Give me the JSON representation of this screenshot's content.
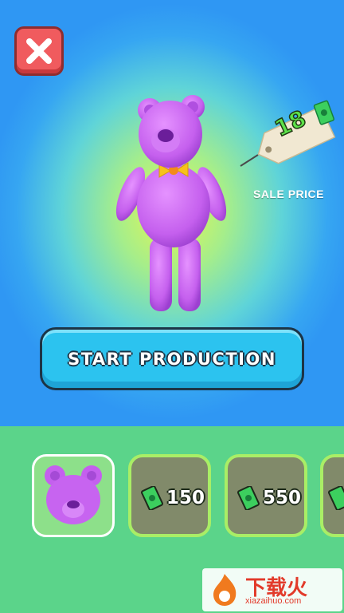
{
  "product": {
    "name_icon": "teddy-bear",
    "color": "#c764f0",
    "sale_price": "18",
    "sale_price_label": "SALE PRICE"
  },
  "actions": {
    "start_label": "START PRODUCTION",
    "close_icon": "close-icon"
  },
  "shop": {
    "items": [
      {
        "icon": "teddy-bear-head",
        "state": "selected"
      },
      {
        "icon": "cash-icon",
        "cost": "150",
        "state": "locked"
      },
      {
        "icon": "cash-icon",
        "cost": "550",
        "state": "locked"
      },
      {
        "icon": "cash-icon",
        "state": "locked"
      }
    ]
  },
  "watermark": {
    "logo_text": "下载火",
    "site": "xiazaihuo.com"
  },
  "colors": {
    "accent_button": "#2cc3ef",
    "close_button": "#f05b5e",
    "shelf": "#5bd48a",
    "price_text": "#5de24a"
  }
}
